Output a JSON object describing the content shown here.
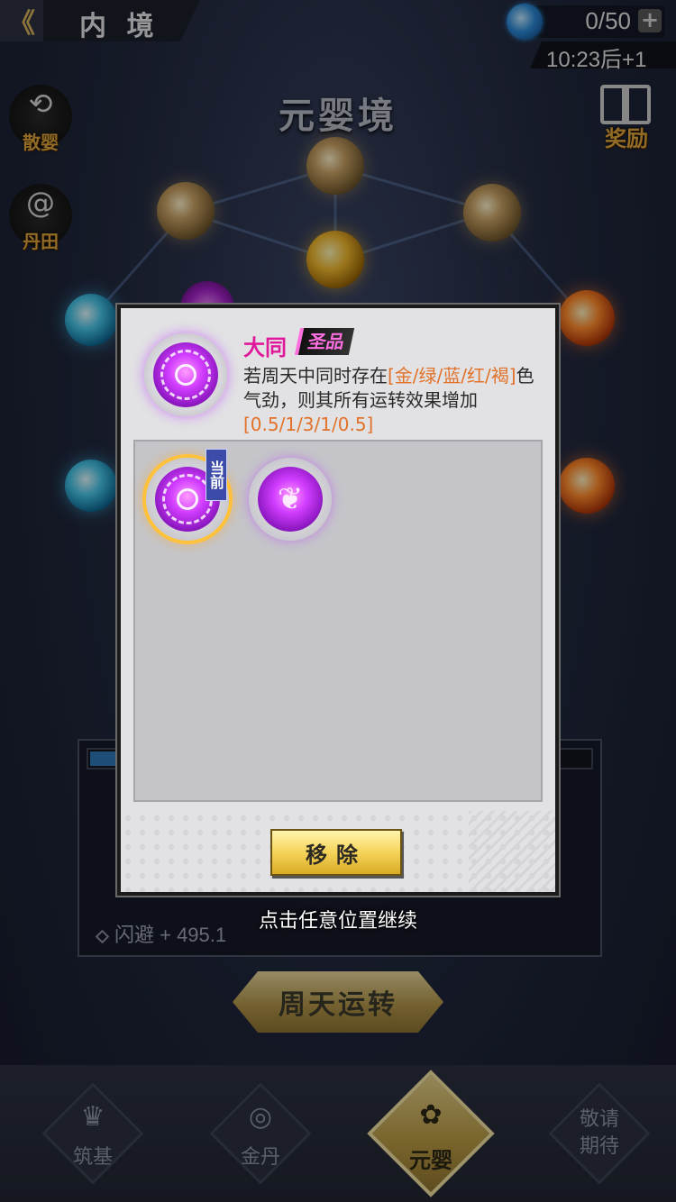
{
  "header": {
    "back_glyph": "《",
    "title": "内 境",
    "energy": "0/50",
    "plus": "+",
    "timer": "10:23后+1"
  },
  "realm": {
    "title": "元婴境"
  },
  "side_buttons": [
    {
      "label": "散婴",
      "icon": "refresh-arrows-icon"
    },
    {
      "label": "丹田",
      "icon": "spiral-flame-icon"
    },
    {
      "label": "奖励",
      "icon": "gift-icon"
    }
  ],
  "stats": {
    "visible_row": "闪避 + 495.1"
  },
  "cycle_button": "周天运转",
  "bottom_nav": [
    {
      "label": "筑基",
      "icon": "lotus-icon",
      "active": false
    },
    {
      "label": "金丹",
      "icon": "swirl-icon",
      "active": false
    },
    {
      "label": "元婴",
      "icon": "flower-icon",
      "active": true
    },
    {
      "label": "敬请\n期待",
      "icon": "",
      "active": false
    }
  ],
  "modal": {
    "skill_name": "大同",
    "grade": "圣品",
    "desc_1": "若周天中同时存在",
    "desc_hl_1": "[金/绿/蓝/红/褐]",
    "desc_2": "色气劲，则其所有运转效果增加",
    "desc_hl_2": "[0.5/1/3/1/0.5]",
    "current_tag": "当前",
    "slots": [
      {
        "icon": "bagua-icon",
        "current": true
      },
      {
        "icon": "butterfly-icon",
        "current": false
      }
    ],
    "remove_button": "移除"
  },
  "hint": "点击任意位置继续",
  "colors": {
    "grade_pink": "#e0189a",
    "highlight_orange": "#e2712a",
    "button_gold": "#f5d35a"
  }
}
